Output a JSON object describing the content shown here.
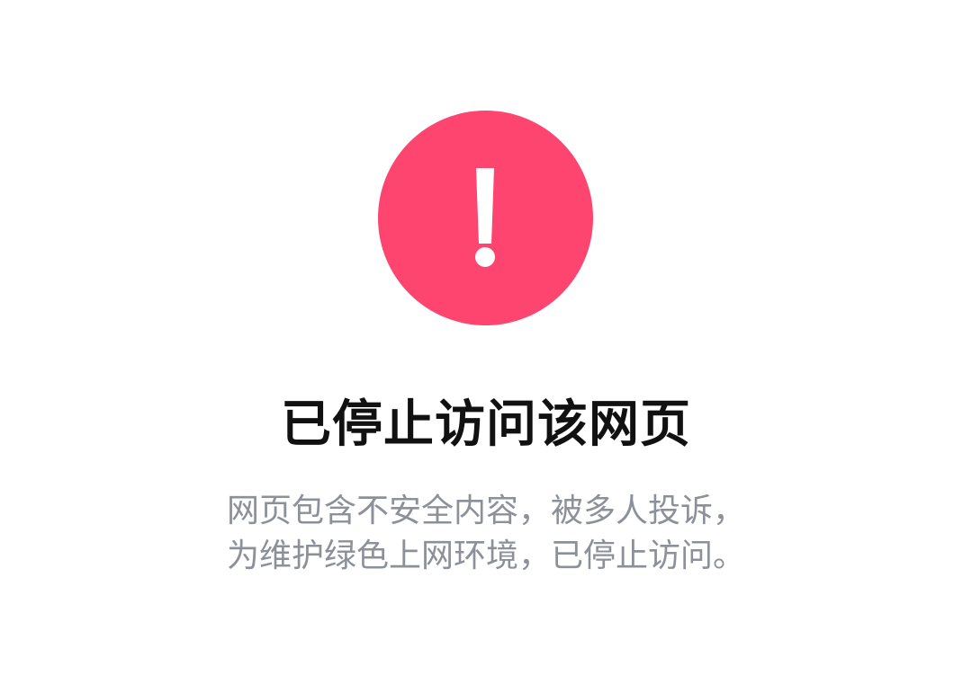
{
  "icon": {
    "name": "exclamation-icon",
    "color": "#fe4570"
  },
  "title": "已停止访问该网页",
  "description": {
    "line1": "网页包含不安全内容，被多人投诉，",
    "line2": "为维护绿色上网环境，已停止访问。"
  }
}
